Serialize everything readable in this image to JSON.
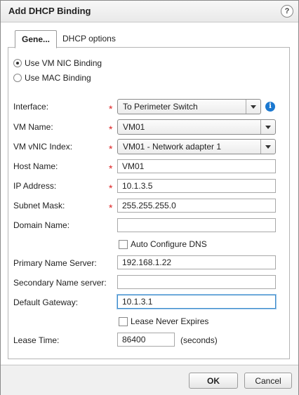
{
  "dialog": {
    "title": "Add DHCP Binding",
    "help_label": "?"
  },
  "tabs": [
    {
      "label": "Gene...",
      "active": true
    },
    {
      "label": "DHCP options",
      "active": false
    }
  ],
  "binding_options": [
    {
      "label": "Use VM NIC Binding",
      "checked": true
    },
    {
      "label": "Use MAC Binding",
      "checked": false
    }
  ],
  "form": {
    "interface": {
      "label": "Interface:",
      "value": "To Perimeter Switch",
      "required": true
    },
    "vm_name": {
      "label": "VM Name:",
      "value": "VM01",
      "required": true
    },
    "vm_vnic_index": {
      "label": "VM vNIC Index:",
      "value": "VM01 - Network adapter 1",
      "required": true
    },
    "host_name": {
      "label": "Host Name:",
      "value": "VM01",
      "required": true
    },
    "ip_address": {
      "label": "IP Address:",
      "value": "10.1.3.5",
      "required": true
    },
    "subnet_mask": {
      "label": "Subnet Mask:",
      "value": "255.255.255.0",
      "required": true
    },
    "domain_name": {
      "label": "Domain Name:",
      "value": ""
    },
    "auto_configure_dns": {
      "label": "Auto Configure DNS",
      "checked": false
    },
    "primary_name_server": {
      "label": "Primary Name Server:",
      "value": "192.168.1.22"
    },
    "secondary_name_server": {
      "label": "Secondary Name server:",
      "value": ""
    },
    "default_gateway": {
      "label": "Default Gateway:",
      "value": "10.1.3.1",
      "focused": true
    },
    "lease_never_expires": {
      "label": "Lease Never Expires",
      "checked": false
    },
    "lease_time": {
      "label": "Lease Time:",
      "value": "86400",
      "unit": "(seconds)"
    }
  },
  "required_marker": "*",
  "info_icon_glyph": "i",
  "buttons": {
    "ok": "OK",
    "cancel": "Cancel"
  },
  "colors": {
    "required": "#dd2222",
    "info": "#1b78d0",
    "focus": "#3c8ac9"
  }
}
